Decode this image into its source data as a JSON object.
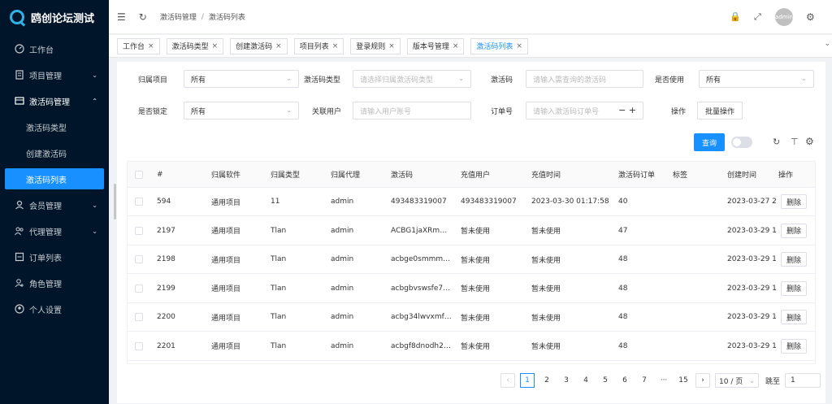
{
  "brand": {
    "title": "鸥创论坛测试"
  },
  "sidebar": {
    "items": [
      {
        "label": "工作台"
      },
      {
        "label": "项目管理"
      },
      {
        "label": "激活码管理"
      },
      {
        "label": "会员管理"
      },
      {
        "label": "代理管理"
      },
      {
        "label": "订单列表"
      },
      {
        "label": "角色管理"
      },
      {
        "label": "个人设置"
      }
    ],
    "sub": [
      {
        "label": "激活码类型"
      },
      {
        "label": "创建激活码"
      },
      {
        "label": "激活码列表"
      }
    ]
  },
  "header": {
    "crumb1": "激活码管理",
    "crumb_sep": "/",
    "crumb2": "激活码列表",
    "avatar": "admin"
  },
  "tabs": [
    {
      "label": "工作台"
    },
    {
      "label": "激活码类型"
    },
    {
      "label": "创建激活码"
    },
    {
      "label": "项目列表"
    },
    {
      "label": "登录规则"
    },
    {
      "label": "版本号管理"
    },
    {
      "label": "激活码列表"
    }
  ],
  "filters": {
    "project_label": "归属项目",
    "project_value": "所有",
    "type_label": "激活码类型",
    "type_placeholder": "请选择归属激活码类型",
    "code_label": "激活码",
    "code_placeholder": "请输入需查询的激活码",
    "used_label": "是否使用",
    "used_value": "所有",
    "locked_label": "是否锁定",
    "locked_value": "所有",
    "user_label": "关联用户",
    "user_placeholder": "请输入用户账号",
    "order_label": "订单号",
    "order_placeholder": "请输入激活码订单号",
    "op_label": "操作",
    "batch_label": "批量操作",
    "query_label": "查询"
  },
  "table": {
    "headers": [
      "#",
      "归属软件",
      "归属类型",
      "归属代理",
      "激活码",
      "充值用户",
      "充值时间",
      "激活码订单",
      "标签",
      "创建时间",
      "操作"
    ],
    "rows": [
      [
        "594",
        "通用项目",
        "11",
        "admin",
        "493483319007",
        "493483319007",
        "2023-03-30 01:17:58",
        "40",
        "",
        "2023-03-27 2",
        "删除"
      ],
      [
        "2197",
        "通用项目",
        "Tlan",
        "admin",
        "ACBG1jaXRm…",
        "暂未使用",
        "暂未使用",
        "47",
        "",
        "2023-03-29 1",
        "删除"
      ],
      [
        "2198",
        "通用项目",
        "Tlan",
        "admin",
        "acbge0smmm…",
        "暂未使用",
        "暂未使用",
        "48",
        "",
        "2023-03-29 1",
        "删除"
      ],
      [
        "2199",
        "通用项目",
        "Tlan",
        "admin",
        "acbgbvswsfe7…",
        "暂未使用",
        "暂未使用",
        "48",
        "",
        "2023-03-29 1",
        "删除"
      ],
      [
        "2200",
        "通用项目",
        "Tlan",
        "admin",
        "acbg34lwvxmf…",
        "暂未使用",
        "暂未使用",
        "48",
        "",
        "2023-03-29 1",
        "删除"
      ],
      [
        "2201",
        "通用项目",
        "Tlan",
        "admin",
        "acbgf8dnodh2…",
        "暂未使用",
        "暂未使用",
        "48",
        "",
        "2023-03-29 1",
        "删除"
      ]
    ]
  },
  "pagination": {
    "pages": [
      "1",
      "2",
      "3",
      "4",
      "5",
      "6",
      "7",
      "···",
      "15"
    ],
    "page_size": "10 / 页",
    "goto_label": "跳至",
    "goto_value": "1"
  },
  "colors": {
    "sidebar_bg": "#001529",
    "accent": "#1890ff"
  }
}
